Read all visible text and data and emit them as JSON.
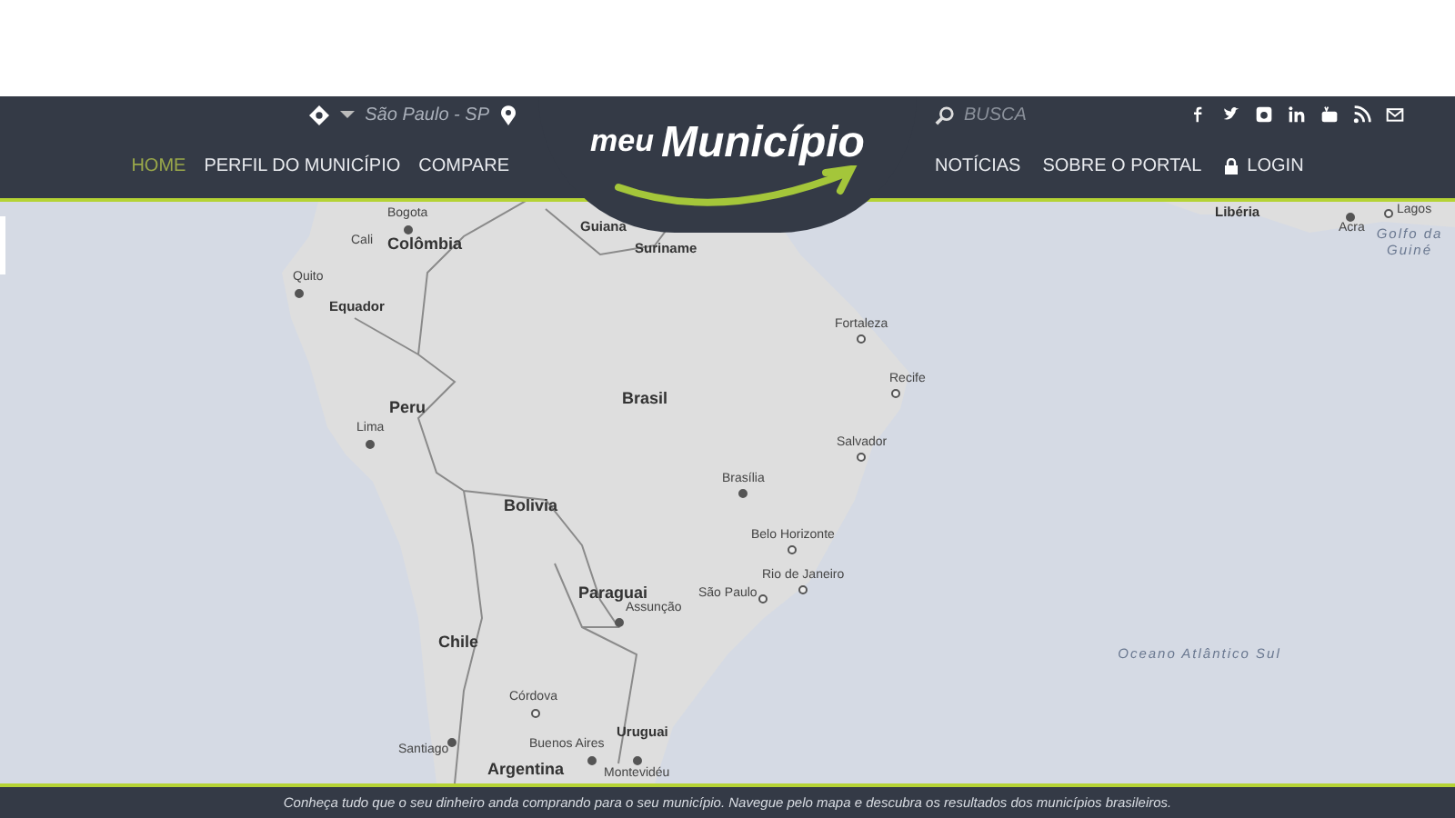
{
  "header": {
    "location": "São Paulo - SP",
    "search": {
      "placeholder": "BUSCA"
    },
    "logo": {
      "word_1": "meu",
      "word_2": "Município"
    },
    "nav_left": [
      {
        "label": "HOME",
        "selected": true
      },
      {
        "label": "PERFIL DO MUNICÍPIO",
        "selected": false
      },
      {
        "label": "COMPARE",
        "selected": false
      }
    ],
    "nav_right": [
      {
        "label": "NOTÍCIAS",
        "selected": false
      },
      {
        "label": "SOBRE O PORTAL",
        "selected": false
      },
      {
        "label": "LOGIN",
        "selected": false
      }
    ],
    "social": [
      {
        "kind": "facebook"
      },
      {
        "kind": "twitter"
      },
      {
        "kind": "instagram"
      },
      {
        "kind": "linkedin"
      },
      {
        "kind": "youtube"
      },
      {
        "kind": "rss"
      },
      {
        "kind": "mail"
      }
    ]
  },
  "map": {
    "labels": [
      {
        "text": "Bogota",
        "kind": "city"
      },
      {
        "text": "Cali",
        "kind": "town"
      },
      {
        "text": "Colômbia",
        "kind": "country"
      },
      {
        "text": "Quito",
        "kind": "city"
      },
      {
        "text": "Equador",
        "kind": "region"
      },
      {
        "text": "Guiana",
        "kind": "region"
      },
      {
        "text": "Suriname",
        "kind": "region"
      },
      {
        "text": "Peru",
        "kind": "country"
      },
      {
        "text": "Lima",
        "kind": "city"
      },
      {
        "text": "Brasil",
        "kind": "country"
      },
      {
        "text": "Fortaleza",
        "kind": "town"
      },
      {
        "text": "Recife",
        "kind": "town"
      },
      {
        "text": "Salvador",
        "kind": "town"
      },
      {
        "text": "Brasília",
        "kind": "city"
      },
      {
        "text": "Bolivia",
        "kind": "country"
      },
      {
        "text": "Belo Horizonte",
        "kind": "town"
      },
      {
        "text": "Rio de Janeiro",
        "kind": "town"
      },
      {
        "text": "São Paulo",
        "kind": "town"
      },
      {
        "text": "Paraguai",
        "kind": "country"
      },
      {
        "text": "Assunção",
        "kind": "city"
      },
      {
        "text": "Chile",
        "kind": "country"
      },
      {
        "text": "Córdova",
        "kind": "town"
      },
      {
        "text": "Santiago",
        "kind": "city"
      },
      {
        "text": "Uruguai",
        "kind": "region"
      },
      {
        "text": "Buenos Aires",
        "kind": "city"
      },
      {
        "text": "Argentina",
        "kind": "country"
      },
      {
        "text": "Montevidéu",
        "kind": "city"
      },
      {
        "text": "Libéria",
        "kind": "region"
      },
      {
        "text": "Acra",
        "kind": "city"
      },
      {
        "text": "Lagos",
        "kind": "town"
      },
      {
        "text": "Golfo da Guiné",
        "kind": "water"
      },
      {
        "text": "Oceano Atlântico Sul",
        "kind": "water"
      }
    ]
  },
  "footer": {
    "text": "Conheça tudo que o seu dinheiro anda comprando para o seu município. Navegue pelo mapa e descubra os resultados dos municípios brasileiros."
  }
}
